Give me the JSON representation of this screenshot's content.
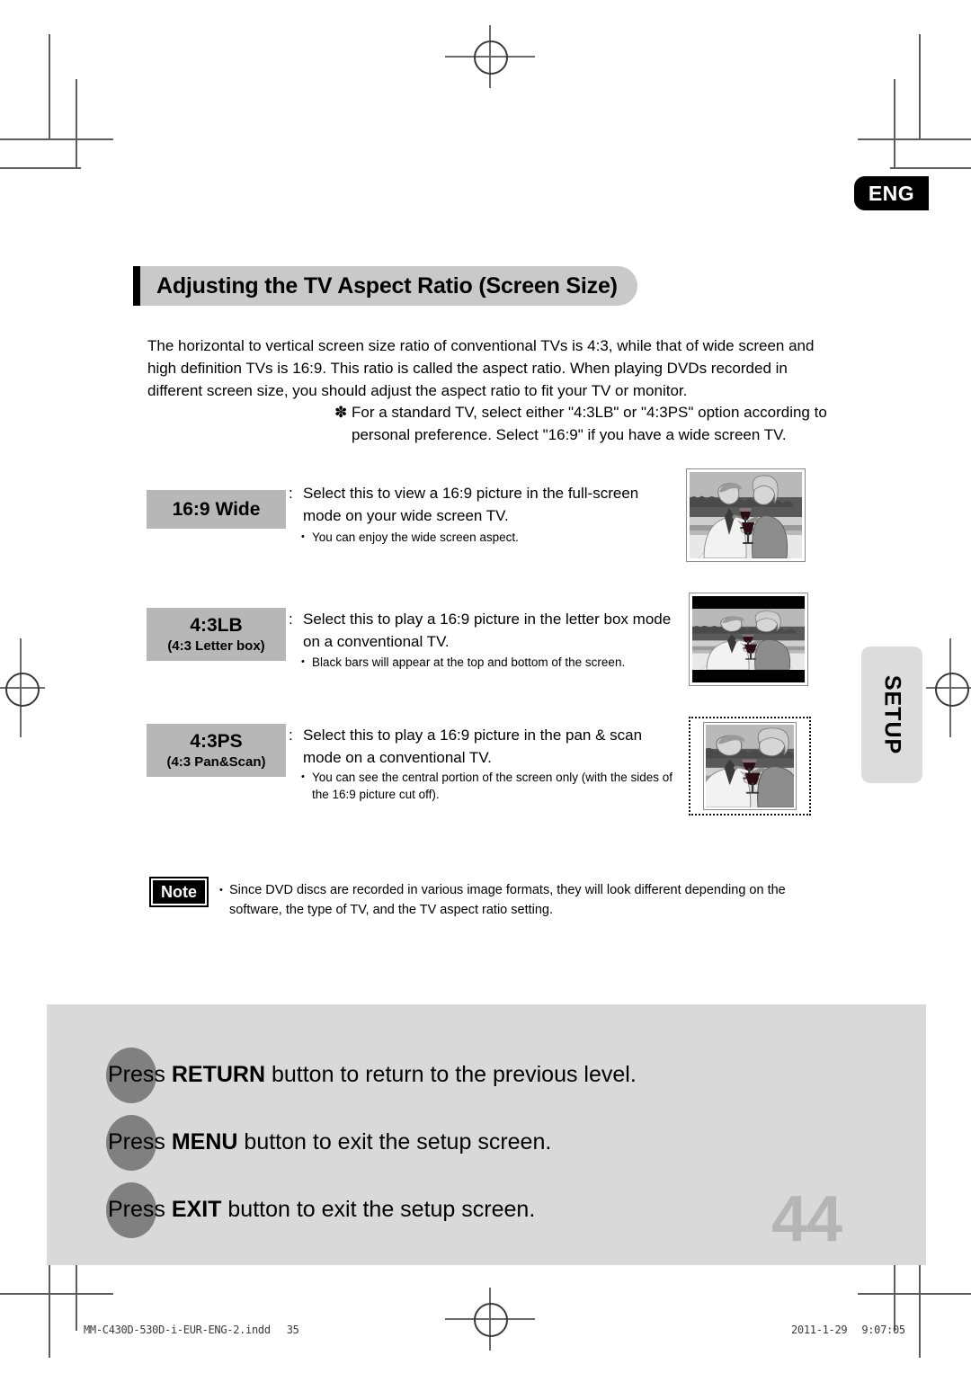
{
  "language_badge": "ENG",
  "side_tab": "SETUP",
  "heading": "Adjusting the TV Aspect Ratio (Screen Size)",
  "intro": "The horizontal to vertical screen size ratio of conventional TVs is 4:3, while that of wide screen and high definition TVs is 16:9. This ratio is called the aspect ratio. When playing DVDs recorded in different screen size, you should adjust the aspect ratio to fit your TV or monitor.",
  "star_note": {
    "marker": "✽",
    "text": "For a standard TV, select either \"4:3LB\" or \"4:3PS\" option according to personal preference. Select \"16:9\" if you have a wide screen TV."
  },
  "options": [
    {
      "chip_main": "16:9 Wide",
      "chip_sub": "",
      "colon": ":",
      "description": "Select this to view a 16:9 picture in the full-screen mode on your wide screen TV.",
      "bullet_marker": "•",
      "bullet": "You can enjoy the wide screen aspect.",
      "thumb_mode": "wide"
    },
    {
      "chip_main": "4:3LB",
      "chip_sub": "(4:3 Letter box)",
      "colon": ":",
      "description": "Select this to play a 16:9 picture in the letter box mode on a conventional TV.",
      "bullet_marker": "•",
      "bullet": "Black bars will appear at the top and bottom of the screen.",
      "thumb_mode": "letterbox"
    },
    {
      "chip_main": "4:3PS",
      "chip_sub": "(4:3 Pan&Scan)",
      "colon": ":",
      "description": "Select this to play a 16:9 picture in the pan & scan mode on a conventional TV.",
      "bullet_marker": "•",
      "bullet": "You can see the central portion of the screen only (with the sides of the 16:9 picture cut off).",
      "thumb_mode": "panscan"
    }
  ],
  "note": {
    "badge": "Note",
    "marker": "•",
    "text": "Since DVD discs are recorded in various image formats, they will look different depending on the software, the type of TV, and the TV aspect ratio setting."
  },
  "bottom_panel": {
    "rows": [
      {
        "prefix": "Press ",
        "key": "RETURN",
        "suffix": " button to return to the previous level."
      },
      {
        "prefix": "Press ",
        "key": "MENU",
        "suffix": " button to exit the setup screen."
      },
      {
        "prefix": "Press ",
        "key": "EXIT",
        "suffix": " button to exit the setup screen."
      }
    ]
  },
  "page_number": "44",
  "footer": {
    "file_name": "MM-C430D-530D-i-EUR-ENG-2.indd",
    "sheet_number": "35",
    "date": "2011-1-29",
    "time": "9:07:05"
  },
  "colors": {
    "heading_pill": "#c9c9c9",
    "chip": "#b7b7b7",
    "panel": "#d9d9d9",
    "dot": "#808080",
    "badge_black": "#000000",
    "page_number": "#b5b5b5"
  }
}
